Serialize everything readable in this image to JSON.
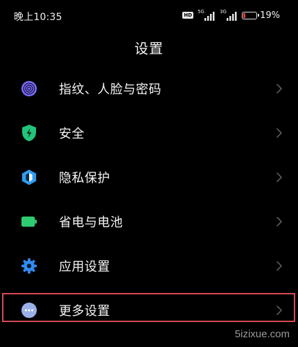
{
  "status_bar": {
    "time": "晚上10:35",
    "hd_badge": "HD",
    "network_1": "5G",
    "network_2": "3G",
    "battery_percent": "19%",
    "battery_level": 0.19,
    "battery_color": "#ff3b30"
  },
  "header": {
    "title": "设置"
  },
  "settings": {
    "items": [
      {
        "label": "指纹、人脸与密码",
        "icon": "fingerprint-icon",
        "color": "#7b6cf6"
      },
      {
        "label": "安全",
        "icon": "shield-icon",
        "color": "#22c47a"
      },
      {
        "label": "隐私保护",
        "icon": "privacy-icon",
        "color": "#2f9cf0"
      },
      {
        "label": "省电与电池",
        "icon": "battery-icon",
        "color": "#2ecc71"
      },
      {
        "label": "应用设置",
        "icon": "gear-icon",
        "color": "#2f8cf0"
      },
      {
        "label": "更多设置",
        "icon": "more-icon",
        "color": "#9ab0e8"
      }
    ]
  },
  "watermark": "5izixue.com"
}
